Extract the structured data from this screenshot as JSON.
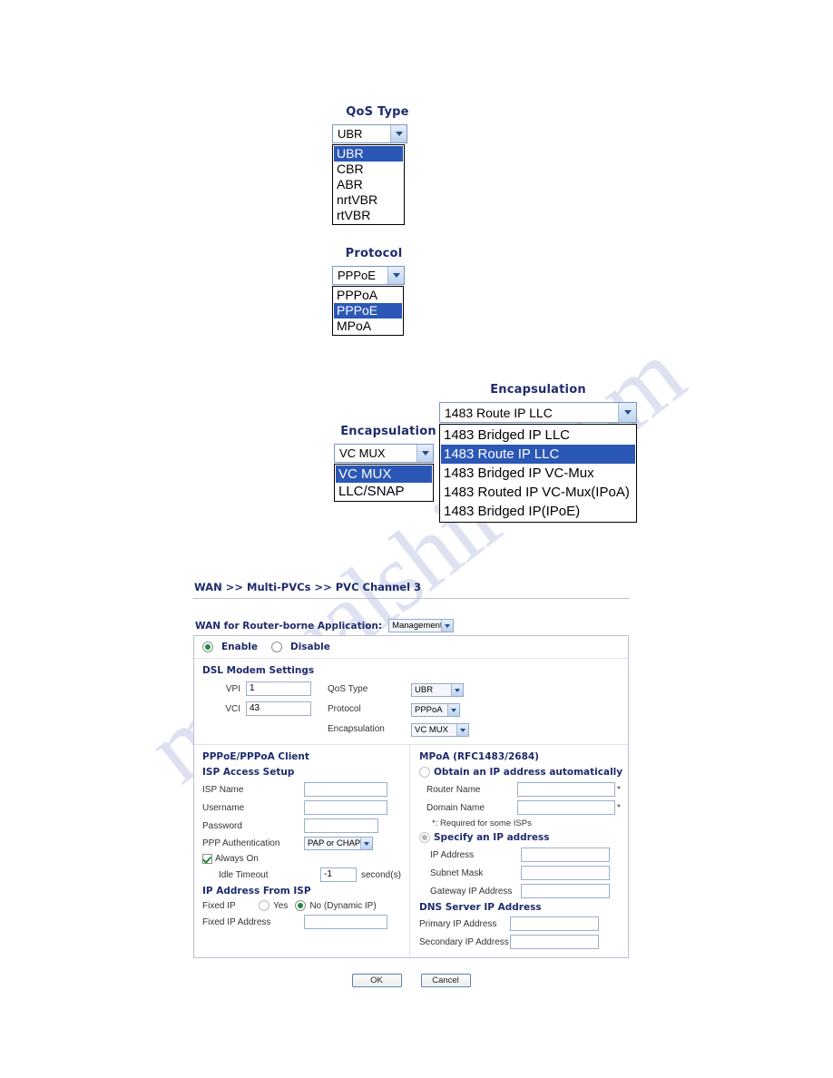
{
  "watermark": {
    "text": "manualshire.com"
  },
  "figures": {
    "qos": {
      "heading": "QoS Type",
      "selected": "UBR",
      "options": [
        "UBR",
        "CBR",
        "ABR",
        "nrtVBR",
        "rtVBR"
      ],
      "selected_index": 0
    },
    "protocol": {
      "heading": "Protocol",
      "selected": "PPPoE",
      "options": [
        "PPPoA",
        "PPPoE",
        "MPoA"
      ],
      "selected_index": 1
    },
    "encapsulation_vcmux": {
      "heading": "Encapsulation",
      "selected": "VC MUX",
      "options": [
        "VC MUX",
        "LLC/SNAP"
      ],
      "selected_index": 0
    },
    "encapsulation_1483": {
      "heading": "Encapsulation",
      "selected": "1483 Route IP LLC",
      "options": [
        "1483 Bridged IP LLC",
        "1483 Route IP LLC",
        "1483 Bridged IP VC-Mux",
        "1483 Routed IP VC-Mux(IPoA)",
        "1483 Bridged IP(IPoE)"
      ],
      "selected_index": 1
    }
  },
  "config_page": {
    "breadcrumb": {
      "part1": "WAN",
      "sep1": ">>",
      "part2": "Multi-PVCs",
      "sep2": ">>",
      "part3": "PVC Channel 3"
    },
    "wan_application": {
      "label": "WAN for Router-borne Application:",
      "value": "Management"
    },
    "enable_row": {
      "enable_label": "Enable",
      "disable_label": "Disable",
      "selected": "Enable"
    },
    "dsl_modem": {
      "title": "DSL Modem Settings",
      "vpi_label": "VPI",
      "vpi_value": "1",
      "vci_label": "VCI",
      "vci_value": "43",
      "qos_label": "QoS Type",
      "qos_value": "UBR",
      "protocol_label": "Protocol",
      "protocol_value": "PPPoA",
      "encapsulation_label": "Encapsulation",
      "encapsulation_value": "VC MUX"
    },
    "left_column": {
      "title": "PPPoE/PPPoA Client",
      "subtitle": "ISP Access Setup",
      "isp_name_label": "ISP Name",
      "isp_name_value": "",
      "username_label": "Username",
      "username_value": "",
      "password_label": "Password",
      "password_value": "",
      "ppp_auth_label": "PPP Authentication",
      "ppp_auth_value": "PAP or CHAP",
      "always_on_label": "Always On",
      "always_on_checked": true,
      "idle_timeout_label": "Idle Timeout",
      "idle_timeout_value": "-1",
      "idle_timeout_unit": "second(s)",
      "ip_from_isp_title": "IP Address From ISP",
      "fixed_ip_label": "Fixed IP",
      "fixed_ip_yes": "Yes",
      "fixed_ip_no": "No (Dynamic IP)",
      "fixed_ip_selected": "No (Dynamic IP)",
      "fixed_ip_address_label": "Fixed IP Address",
      "fixed_ip_address_value": ""
    },
    "right_column": {
      "title": "MPoA (RFC1483/2684)",
      "obtain_auto_label": "Obtain an IP address automatically",
      "router_name_label": "Router Name",
      "router_name_value": "",
      "domain_name_label": "Domain Name",
      "domain_name_value": "",
      "required_note": "*: Required for some ISPs",
      "specify_ip_label": "Specify an IP address",
      "ip_address_label": "IP Address",
      "ip_address_value": "",
      "subnet_mask_label": "Subnet Mask",
      "subnet_mask_value": "",
      "gateway_label": "Gateway IP Address",
      "gateway_value": "",
      "dns_title": "DNS Server IP Address",
      "primary_dns_label": "Primary IP Address",
      "primary_dns_value": "",
      "secondary_dns_label": "Secondary IP Address",
      "secondary_dns_value": "",
      "star": "*"
    },
    "buttons": {
      "ok": "OK",
      "cancel": "Cancel"
    }
  }
}
